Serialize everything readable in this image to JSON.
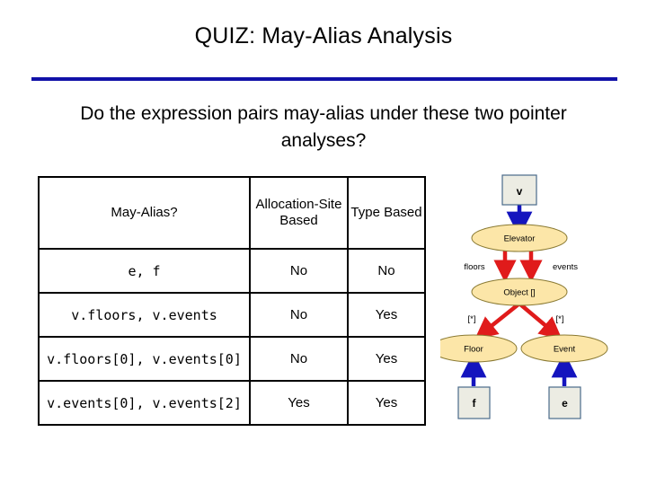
{
  "slide": {
    "title": "QUIZ: May-Alias Analysis",
    "subtitle": "Do the expression pairs may-alias under these two pointer analyses?",
    "rule_color": "#1111A8"
  },
  "table": {
    "headers": {
      "expression": "May-Alias?",
      "allocation_site": "Allocation-Site Based",
      "type_based": "Type Based"
    },
    "rows": [
      {
        "expression": "e, f",
        "allocation_site": "No",
        "type_based": "No"
      },
      {
        "expression": "v.floors, v.events",
        "allocation_site": "No",
        "type_based": "Yes"
      },
      {
        "expression": "v.floors[0], v.events[0]",
        "allocation_site": "No",
        "type_based": "Yes"
      },
      {
        "expression": "v.events[0], v.events[2]",
        "allocation_site": "Yes",
        "type_based": "Yes"
      }
    ]
  },
  "diagram": {
    "colors": {
      "box_fill": "#ECECE3",
      "box_stroke": "#4A6A8A",
      "ellipse_fill": "#FCE6A8",
      "ellipse_stroke": "#8A7A33",
      "blue_arrow": "#1414BE",
      "red_arrow": "#E01B1B"
    },
    "nodes": {
      "var_v": "v",
      "elevator": "Elevator",
      "object_array": "Object []",
      "floor": "Floor",
      "event": "Event",
      "var_f": "f",
      "var_e": "e"
    },
    "edge_labels": {
      "floors": "floors",
      "events": "events",
      "star_left": "[*]",
      "star_right": "[*]"
    }
  }
}
